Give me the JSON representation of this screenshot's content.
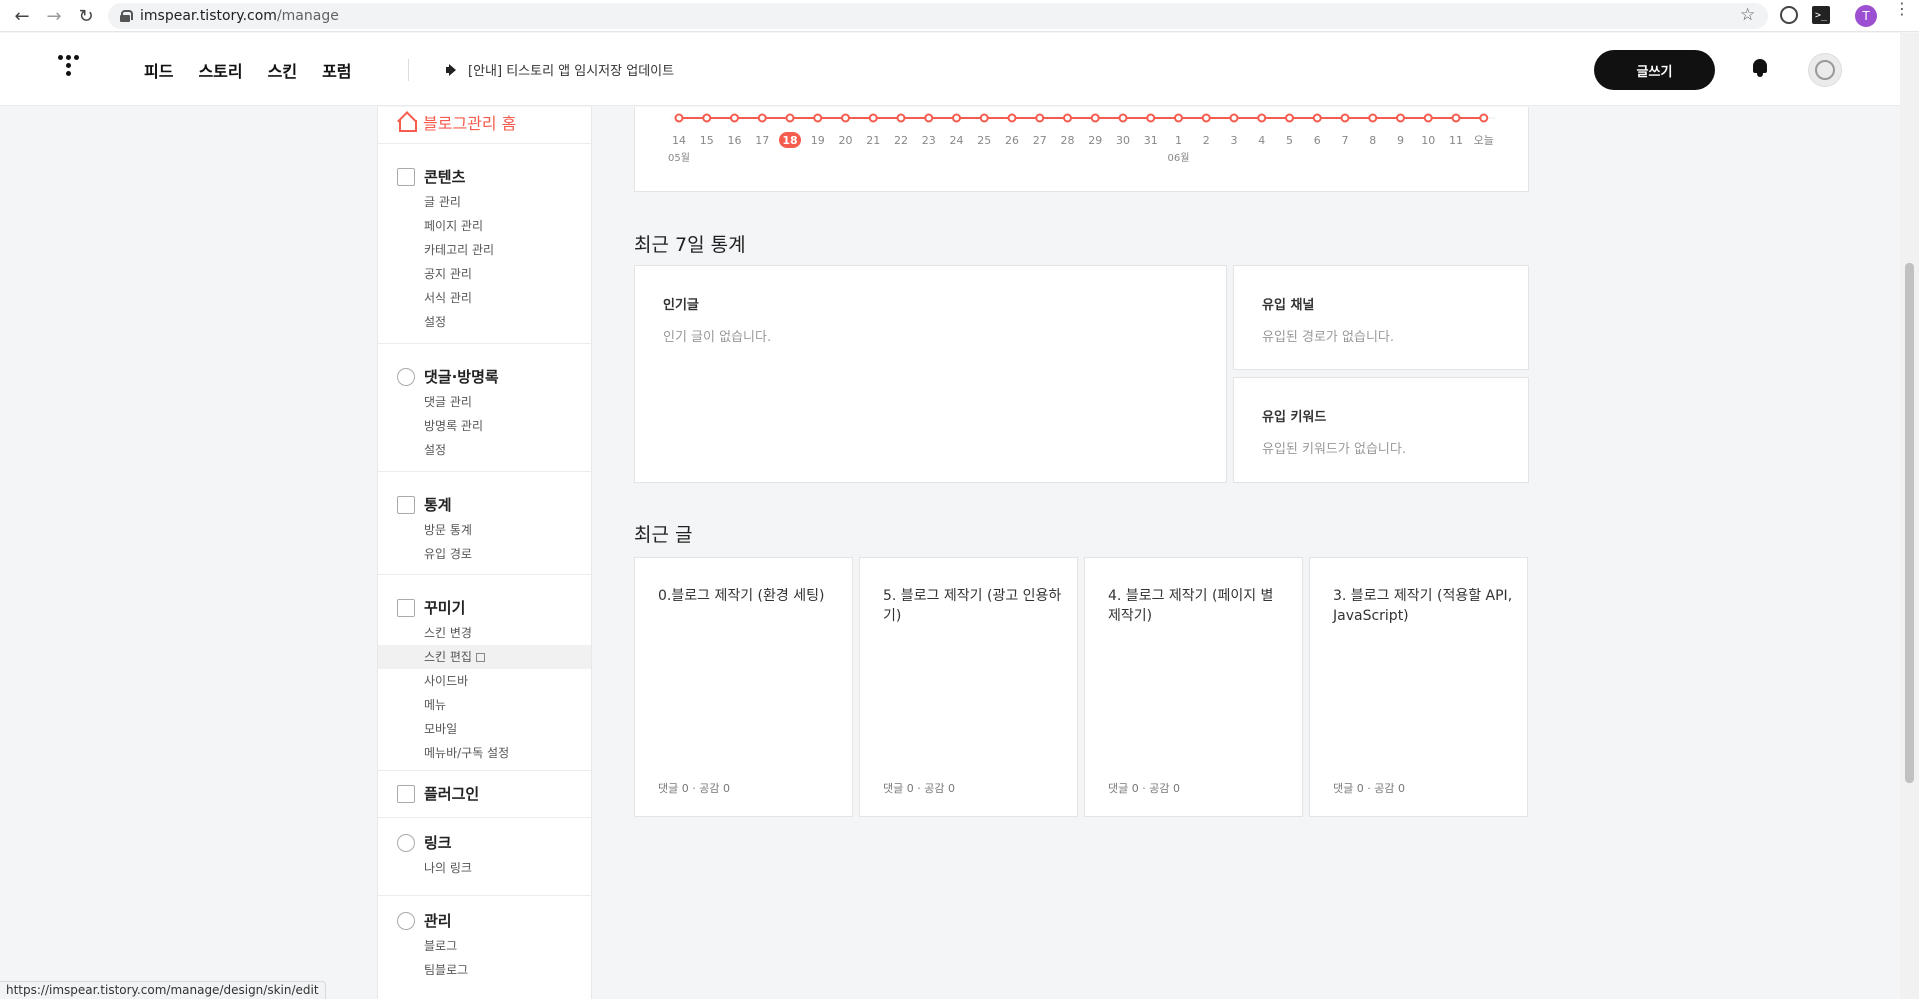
{
  "browser": {
    "url_host": "imspear.tistory.com",
    "url_path": "/manage",
    "profile_initial": "T",
    "status_url": "https://imspear.tistory.com/manage/design/skin/edit"
  },
  "header": {
    "nav": [
      "피드",
      "스토리",
      "스킨",
      "포럼"
    ],
    "notice": "[안내] 티스토리 앱 임시저장 업데이트",
    "write_button": "글쓰기"
  },
  "sidebar": {
    "home": "블로그관리 홈",
    "sections": [
      {
        "title": "콘텐츠",
        "items": [
          "글 관리",
          "페이지 관리",
          "카테고리 관리",
          "공지 관리",
          "서식 관리",
          "설정"
        ]
      },
      {
        "title": "댓글·방명록",
        "items": [
          "댓글 관리",
          "방명록 관리",
          "설정"
        ]
      },
      {
        "title": "통계",
        "items": [
          "방문 통계",
          "유입 경로"
        ]
      },
      {
        "title": "꾸미기",
        "items": [
          "스킨 변경",
          "스킨 편집",
          "사이드바",
          "메뉴",
          "모바일",
          "메뉴바/구독 설정"
        ]
      },
      {
        "title": "플러그인",
        "items": []
      },
      {
        "title": "링크",
        "items": [
          "나의 링크"
        ]
      },
      {
        "title": "관리",
        "items": [
          "블로그",
          "팀블로그"
        ]
      }
    ]
  },
  "chart_data": {
    "type": "line",
    "x": [
      "14",
      "15",
      "16",
      "17",
      "18",
      "19",
      "20",
      "21",
      "22",
      "23",
      "24",
      "25",
      "26",
      "27",
      "28",
      "29",
      "30",
      "31",
      "1",
      "2",
      "3",
      "4",
      "5",
      "6",
      "7",
      "8",
      "9",
      "10",
      "11",
      "오늘"
    ],
    "month_labels": [
      {
        "index": 0,
        "label": "05월"
      },
      {
        "index": 18,
        "label": "06월"
      }
    ],
    "highlight_index": 4,
    "series": [
      {
        "values": [
          0,
          0,
          0,
          0,
          0,
          0,
          0,
          0,
          0,
          0,
          0,
          0,
          0,
          0,
          0,
          0,
          0,
          0,
          0,
          0,
          0,
          0,
          0,
          0,
          0,
          0,
          0,
          0,
          0,
          0
        ]
      }
    ],
    "color": "#f55c4e"
  },
  "stats": {
    "title": "최근 7일 통계",
    "popular": {
      "title": "인기글",
      "empty": "인기 글이 없습니다."
    },
    "channel": {
      "title": "유입 채널",
      "empty": "유입된 경로가 없습니다."
    },
    "keyword": {
      "title": "유입 키워드",
      "empty": "유입된 키워드가 없습니다."
    }
  },
  "recent": {
    "title": "최근 글",
    "posts": [
      {
        "title": "0.블로그 제작기 (환경 세팅)",
        "meta": "댓글 0 · 공감 0"
      },
      {
        "title": "5. 블로그 제작기 (광고 인용하기)",
        "meta": "댓글 0 · 공감 0"
      },
      {
        "title": "4. 블로그 제작기 (페이지 별 제작기)",
        "meta": "댓글 0 · 공감 0"
      },
      {
        "title": "3. 블로그 제작기 (적용할 API, JavaScript)",
        "meta": "댓글 0 · 공감 0"
      }
    ]
  }
}
